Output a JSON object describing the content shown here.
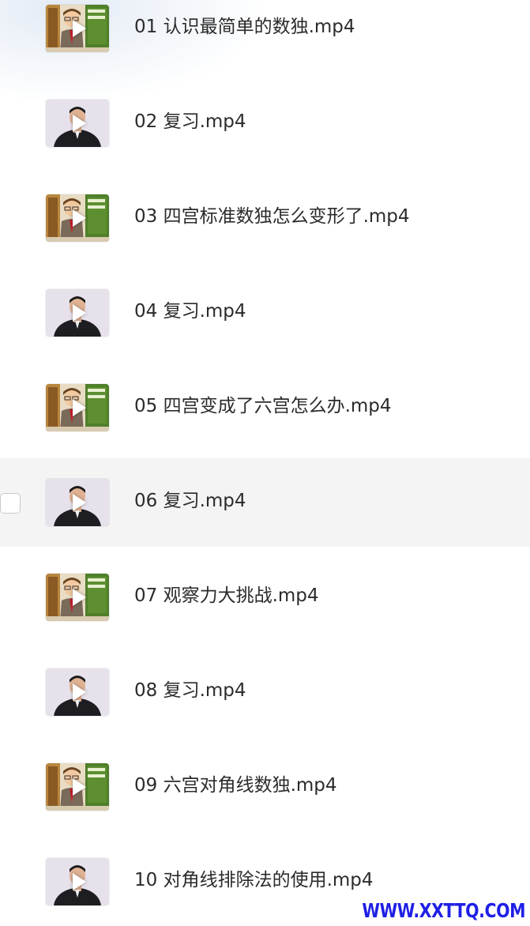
{
  "files": [
    {
      "name": "01 认识最简单的数独.mp4",
      "thumbnail": "cartoon-teacher-thumbnail"
    },
    {
      "name": "02 复习.mp4",
      "thumbnail": "lecturer-thumbnail"
    },
    {
      "name": "03 四宫标准数独怎么变形了.mp4",
      "thumbnail": "cartoon-teacher-thumbnail"
    },
    {
      "name": "04 复习.mp4",
      "thumbnail": "lecturer-thumbnail"
    },
    {
      "name": "05 四宫变成了六宫怎么办.mp4",
      "thumbnail": "cartoon-teacher-thumbnail"
    },
    {
      "name": "06 复习.mp4",
      "thumbnail": "lecturer-thumbnail",
      "hovered": true
    },
    {
      "name": "07 观察力大挑战.mp4",
      "thumbnail": "cartoon-teacher-thumbnail"
    },
    {
      "name": "08 复习.mp4",
      "thumbnail": "lecturer-thumbnail"
    },
    {
      "name": "09 六宫对角线数独.mp4",
      "thumbnail": "cartoon-teacher-thumbnail"
    },
    {
      "name": "10 对角线排除法的使用.mp4",
      "thumbnail": "lecturer-thumbnail"
    }
  ],
  "watermark": "WWW.XXTTQ.COM",
  "colors": {
    "row_hover": "#f4f4f4",
    "file_name_text": "#2b2b2b",
    "watermark": "#1f1fe6"
  },
  "icons": {
    "play": "play-icon",
    "checkbox": "checkbox-icon"
  }
}
